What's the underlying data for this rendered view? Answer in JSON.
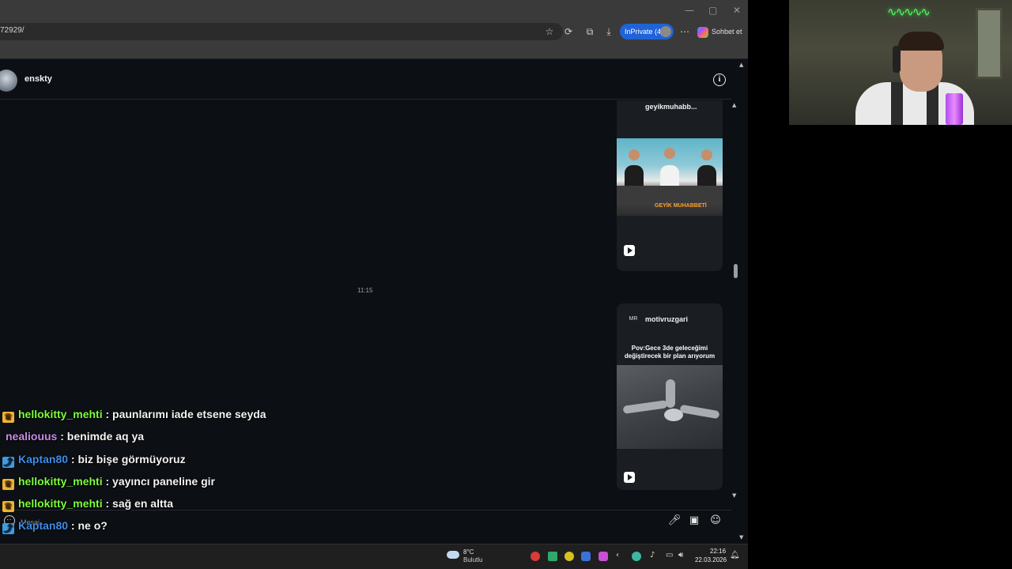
{
  "browser": {
    "url_fragment": "72929/",
    "inprivate_label": "InPrivate (4)",
    "chat_label": "Sohbet et",
    "window_controls": {
      "minimize": "—",
      "maximize": "▢",
      "close": "✕"
    },
    "toolbar_icons": [
      "star-icon",
      "extensions-icon",
      "collections-icon",
      "download-icon",
      "more-icon"
    ]
  },
  "dm": {
    "username": "enskty",
    "timestamp": "11:15",
    "composer_placeholder": "Mesaj...",
    "reels": [
      {
        "handle": "geyikmuhabb...",
        "logo_text": "",
        "overlay_caption": "GEYİK MUHABBETİ"
      },
      {
        "handle": "motivruzgari",
        "logo_text": "MR",
        "caption": "Pov:Gece 3de geleceğimi değiştirecek bir plan arıyorum"
      }
    ]
  },
  "chat_overlay": [
    {
      "badge": "crown",
      "user": "hellokitty_mehti",
      "color": "#7cff3c",
      "message": ": paunlarımı iade etsene seyda"
    },
    {
      "badge": "none",
      "user": "nealiouus",
      "color": "#c98be8",
      "message": ": benimde aq ya"
    },
    {
      "badge": "prime",
      "user": "Kaptan80",
      "color": "#3f8ee8",
      "message": ": biz bişe görmüyoruz"
    },
    {
      "badge": "crown",
      "user": "hellokitty_mehti",
      "color": "#7cff3c",
      "message": ": yayıncı paneline gir"
    },
    {
      "badge": "crown",
      "user": "hellokitty_mehti",
      "color": "#7cff3c",
      "message": ": sağ en altta"
    },
    {
      "badge": "prime",
      "user": "Kaptan80",
      "color": "#3f8ee8",
      "message": ": ne o?"
    }
  ],
  "taskbar": {
    "temperature": "8°C",
    "weather": "Bulutlu",
    "time": "22:16",
    "date": "22.03.2026"
  }
}
